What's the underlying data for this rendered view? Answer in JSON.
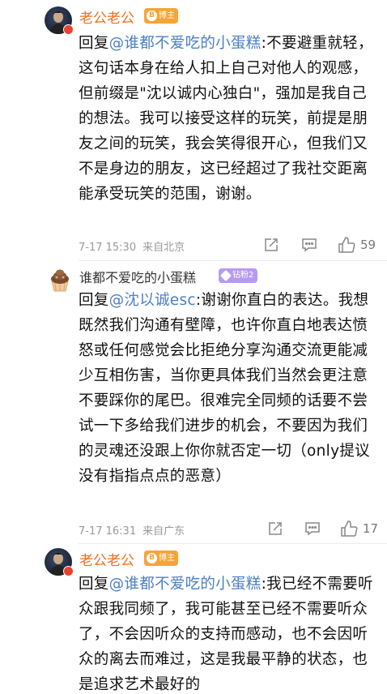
{
  "comments": [
    {
      "user": "老公老公",
      "tag": "博主",
      "reply_prefix": "回复",
      "mention": "@谁都不爱吃的小蛋糕",
      "text": ":不要避重就轻，这句话本身在给人扣上自己对他人的观感，但前缀是\"沈以诚内心独白\"，强加是我自己的想法。我可以接受这样的玩笑，前提是朋友之间的玩笑，我会笑得很开心，但我们又不是身边的朋友，这已经超过了我社交距离能承受玩笑的范围，谢谢。",
      "time": "7-17 15:30",
      "location": "来自北京",
      "likes": "59"
    },
    {
      "user": "谁都不爱吃的小蛋糕",
      "tag": "钻粉2",
      "reply_prefix": "回复",
      "mention": "@沈以诚esc",
      "text": ":谢谢你直白的表达。我想既然我们沟通有壁障，也许你直白地表达愤怒或任何感觉会比拒绝分享沟通交流更能减少互相伤害，当你更具体我们当然会更注意不要踩你的尾巴。很难完全同频的话要不尝试一下多给我们进步的机会，不要因为我们的灵魂还没跟上你你就否定一切（only提议没有指指点点的恶意）",
      "time": "7-17 16:31",
      "location": "来自广东",
      "likes": "17"
    },
    {
      "user": "老公老公",
      "tag": "博主",
      "reply_prefix": "回复",
      "mention": "@谁都不爱吃的小蛋糕",
      "text": ":我已经不需要听众跟我同频了，我可能甚至已经不需要听众了，不会因听众的支持而感动，也不会因听众的离去而难过，这是我最平静的状态，也是追求艺术最好的"
    }
  ],
  "icons": {
    "share": "share-icon",
    "comment": "comment-icon",
    "like": "thumbs-up-icon",
    "verified": "verified-badge-icon"
  },
  "colors": {
    "username_blogger": "#f26d1c",
    "mention": "#4b7fc4",
    "blogger_tag": "#f7a436",
    "diamond_tag": "#b79af0"
  }
}
